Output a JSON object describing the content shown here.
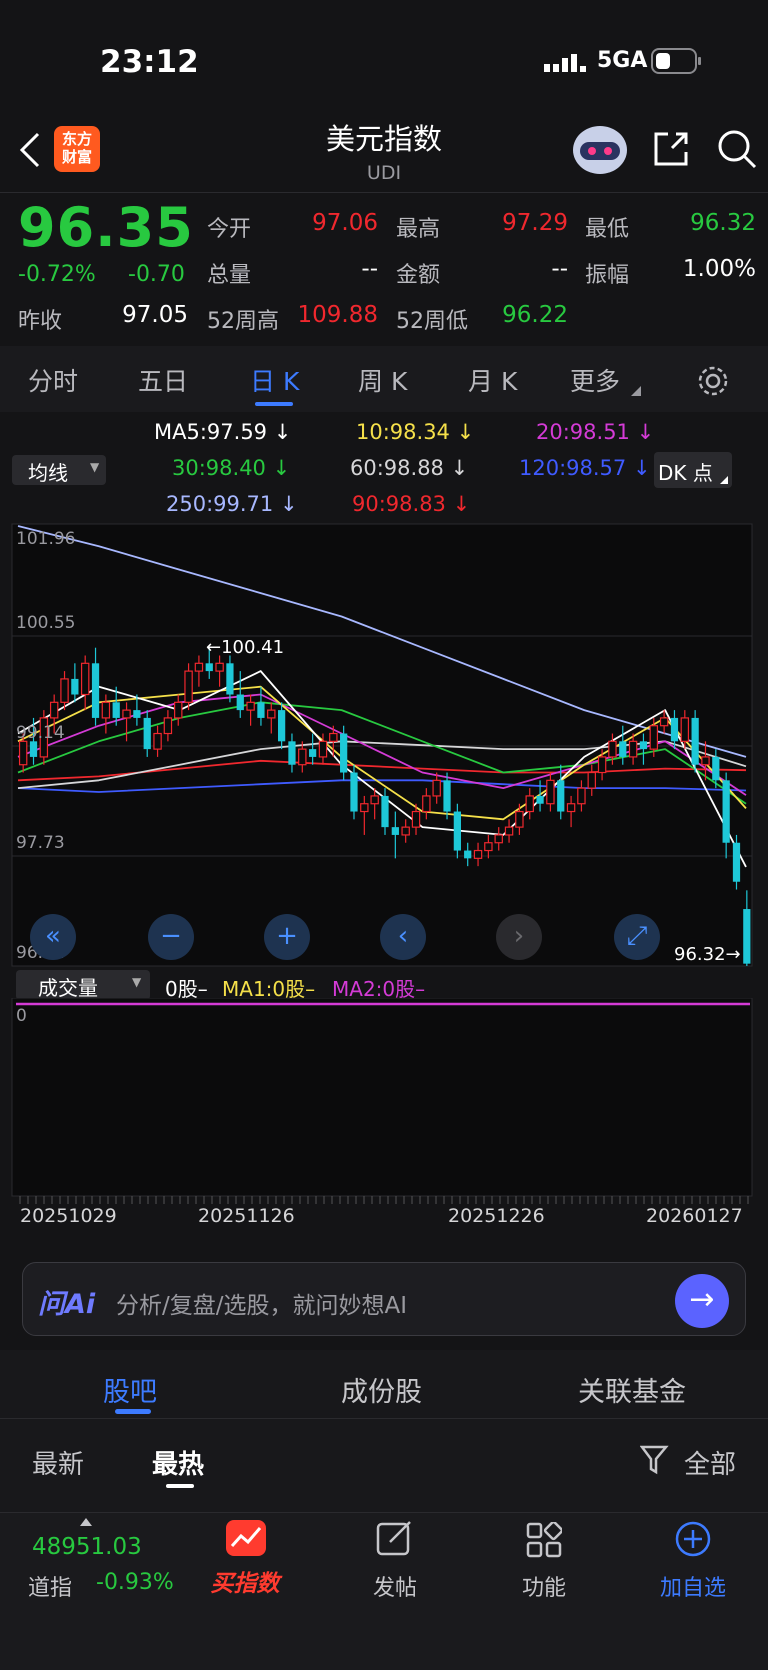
{
  "status": {
    "time": "23:12",
    "network": "5GA"
  },
  "header": {
    "title": "美元指数",
    "code": "UDI",
    "logo_text_1": "东方",
    "logo_text_2": "财富"
  },
  "quote": {
    "price": "96.35",
    "change_pct": "-0.72%",
    "change": "-0.70",
    "prev_close_label": "昨收",
    "prev_close": "97.05",
    "open_label": "今开",
    "open": "97.06",
    "high_label": "最高",
    "high": "97.29",
    "low_label": "最低",
    "low": "96.32",
    "volume_label": "总量",
    "volume": "--",
    "amount_label": "金额",
    "amount": "--",
    "amplitude_label": "振幅",
    "amplitude": "1.00%",
    "w52_high_label": "52周高",
    "w52_high": "109.88",
    "w52_low_label": "52周低",
    "w52_low": "96.22"
  },
  "chart_tabs": {
    "items": [
      "分时",
      "五日",
      "日 K",
      "周 K",
      "月 K",
      "更多"
    ],
    "active": "日 K"
  },
  "indicators": {
    "selector": "均线",
    "dk_button": "DK 点",
    "ma": [
      {
        "label": "MA5:97.59",
        "arrow": "↓",
        "color": "#ffffff"
      },
      {
        "label": "10:98.34",
        "arrow": "↓",
        "color": "#f5e04a"
      },
      {
        "label": "20:98.51",
        "arrow": "↓",
        "color": "#d43bd6"
      },
      {
        "label": "30:98.40",
        "arrow": "↓",
        "color": "#28c940"
      },
      {
        "label": "60:98.88",
        "arrow": "↓",
        "color": "#d6d6d8"
      },
      {
        "label": "120:98.57",
        "arrow": "↓",
        "color": "#3f5bff"
      },
      {
        "label": "250:99.71",
        "arrow": "↓",
        "color": "#a8b8ff"
      },
      {
        "label": "90:98.83",
        "arrow": "↓",
        "color": "#f0282e"
      }
    ]
  },
  "chart_data": {
    "type": "candlestick",
    "y_ticks": [
      "101.96",
      "100.55",
      "99.14",
      "97.73",
      "96.32"
    ],
    "ylim": [
      96.32,
      101.96
    ],
    "x_ticks": [
      "20251029",
      "20251126",
      "20251226",
      "20260127"
    ],
    "max_annotation": "100.41",
    "min_annotation": "96.32",
    "candles": [
      [
        98.9,
        99.3,
        98.8,
        99.2
      ],
      [
        99.2,
        99.5,
        98.9,
        99.0
      ],
      [
        99.0,
        99.6,
        98.9,
        99.5
      ],
      [
        99.5,
        99.8,
        99.3,
        99.7
      ],
      [
        99.7,
        100.1,
        99.6,
        100.0
      ],
      [
        100.0,
        100.2,
        99.7,
        99.8
      ],
      [
        99.8,
        100.3,
        99.6,
        100.2
      ],
      [
        100.2,
        100.4,
        99.4,
        99.5
      ],
      [
        99.5,
        99.8,
        99.3,
        99.7
      ],
      [
        99.7,
        99.9,
        99.4,
        99.5
      ],
      [
        99.5,
        99.7,
        99.2,
        99.6
      ],
      [
        99.6,
        99.8,
        99.4,
        99.5
      ],
      [
        99.5,
        99.6,
        99.0,
        99.1
      ],
      [
        99.1,
        99.4,
        99.0,
        99.3
      ],
      [
        99.3,
        99.6,
        99.2,
        99.5
      ],
      [
        99.5,
        99.8,
        99.4,
        99.7
      ],
      [
        99.7,
        100.2,
        99.6,
        100.1
      ],
      [
        100.1,
        100.3,
        99.9,
        100.2
      ],
      [
        100.2,
        100.41,
        100.0,
        100.1
      ],
      [
        100.1,
        100.3,
        99.9,
        100.2
      ],
      [
        100.2,
        100.3,
        99.7,
        99.8
      ],
      [
        99.8,
        100.1,
        99.5,
        99.6
      ],
      [
        99.6,
        99.8,
        99.4,
        99.7
      ],
      [
        99.7,
        99.9,
        99.4,
        99.5
      ],
      [
        99.5,
        99.7,
        99.3,
        99.6
      ],
      [
        99.6,
        99.7,
        99.1,
        99.2
      ],
      [
        99.2,
        99.3,
        98.8,
        98.9
      ],
      [
        98.9,
        99.2,
        98.8,
        99.1
      ],
      [
        99.1,
        99.3,
        98.9,
        99.0
      ],
      [
        99.0,
        99.3,
        98.9,
        99.2
      ],
      [
        99.2,
        99.4,
        99.0,
        99.3
      ],
      [
        99.3,
        99.4,
        98.7,
        98.8
      ],
      [
        98.8,
        98.9,
        98.2,
        98.3
      ],
      [
        98.3,
        98.5,
        98.0,
        98.4
      ],
      [
        98.4,
        98.6,
        98.2,
        98.5
      ],
      [
        98.5,
        98.6,
        98.0,
        98.1
      ],
      [
        98.1,
        98.3,
        97.7,
        98.0
      ],
      [
        98.0,
        98.2,
        97.9,
        98.1
      ],
      [
        98.1,
        98.4,
        98.0,
        98.3
      ],
      [
        98.3,
        98.6,
        98.2,
        98.5
      ],
      [
        98.5,
        98.8,
        98.4,
        98.7
      ],
      [
        98.7,
        98.8,
        98.2,
        98.3
      ],
      [
        98.3,
        98.4,
        97.7,
        97.8
      ],
      [
        97.8,
        97.9,
        97.6,
        97.7
      ],
      [
        97.7,
        97.9,
        97.6,
        97.8
      ],
      [
        97.8,
        98.0,
        97.7,
        97.9
      ],
      [
        97.9,
        98.1,
        97.8,
        98.0
      ],
      [
        98.0,
        98.2,
        97.9,
        98.1
      ],
      [
        98.1,
        98.4,
        98.0,
        98.3
      ],
      [
        98.3,
        98.6,
        98.2,
        98.5
      ],
      [
        98.5,
        98.7,
        98.3,
        98.4
      ],
      [
        98.4,
        98.8,
        98.3,
        98.7
      ],
      [
        98.7,
        98.9,
        98.2,
        98.3
      ],
      [
        98.3,
        98.5,
        98.1,
        98.4
      ],
      [
        98.4,
        98.7,
        98.3,
        98.6
      ],
      [
        98.6,
        98.9,
        98.5,
        98.8
      ],
      [
        98.8,
        99.1,
        98.7,
        99.0
      ],
      [
        99.0,
        99.3,
        98.9,
        99.2
      ],
      [
        99.2,
        99.4,
        98.9,
        99.0
      ],
      [
        99.0,
        99.3,
        98.9,
        99.2
      ],
      [
        99.2,
        99.3,
        98.9,
        99.1
      ],
      [
        99.1,
        99.5,
        99.0,
        99.4
      ],
      [
        99.4,
        99.6,
        99.3,
        99.5
      ],
      [
        99.5,
        99.6,
        99.1,
        99.2
      ],
      [
        99.2,
        99.6,
        99.1,
        99.5
      ],
      [
        99.5,
        99.6,
        98.8,
        98.9
      ],
      [
        98.9,
        99.2,
        98.7,
        99.0
      ],
      [
        99.0,
        99.1,
        98.6,
        98.7
      ],
      [
        98.7,
        98.8,
        97.7,
        97.9
      ],
      [
        97.9,
        98.0,
        97.3,
        97.4
      ],
      [
        97.05,
        97.29,
        96.32,
        96.35
      ]
    ],
    "lines": [
      {
        "name": "250",
        "color": "#a8b8ff",
        "points": [
          101.96,
          101.7,
          101.4,
          101.1,
          100.8,
          100.4,
          100.0,
          99.6,
          99.3,
          99.0
        ]
      },
      {
        "name": "120",
        "color": "#3f5bff",
        "points": [
          98.6,
          98.55,
          98.6,
          98.65,
          98.7,
          98.7,
          98.65,
          98.6,
          98.6,
          98.57
        ]
      },
      {
        "name": "90",
        "color": "#f0282e",
        "points": [
          98.7,
          98.75,
          98.85,
          98.95,
          98.9,
          98.85,
          98.8,
          98.8,
          98.85,
          98.83
        ]
      },
      {
        "name": "60",
        "color": "#d6d6d8",
        "points": [
          98.6,
          98.7,
          98.9,
          99.1,
          99.2,
          99.15,
          99.1,
          99.1,
          99.2,
          98.88
        ]
      },
      {
        "name": "30",
        "color": "#28c940",
        "points": [
          98.8,
          99.2,
          99.5,
          99.7,
          99.6,
          99.2,
          98.8,
          98.9,
          99.1,
          98.4
        ]
      },
      {
        "name": "20",
        "color": "#d43bd6",
        "points": [
          99.0,
          99.4,
          99.7,
          99.8,
          99.3,
          98.8,
          98.6,
          98.9,
          99.2,
          98.51
        ]
      },
      {
        "name": "10",
        "color": "#f5e04a",
        "points": [
          99.2,
          99.7,
          99.8,
          99.9,
          99.0,
          98.3,
          98.2,
          98.9,
          99.5,
          98.34
        ]
      },
      {
        "name": "5",
        "color": "#ffffff",
        "points": [
          99.3,
          99.9,
          99.6,
          100.1,
          98.9,
          98.1,
          98.0,
          99.0,
          99.6,
          97.59
        ]
      }
    ]
  },
  "volume": {
    "selector": "成交量",
    "value": "0股",
    "ma1": "MA1:0股",
    "ma2": "MA2:0股",
    "axis_zero": "0"
  },
  "ai": {
    "badge": "问Ai",
    "placeholder": "分析/复盘/选股，就问妙想AI"
  },
  "sub_tabs": {
    "items": [
      "股吧",
      "成份股",
      "关联基金"
    ],
    "active": "股吧"
  },
  "filters": {
    "items": [
      "最新",
      "最热"
    ],
    "active": "最热",
    "all": "全部"
  },
  "bottom_bar": {
    "ticker_value": "48951.03",
    "ticker_name": "道指",
    "ticker_change": "-0.93%",
    "buy_index": "买指数",
    "post": "发帖",
    "functions": "功能",
    "add_watch": "加自选"
  }
}
